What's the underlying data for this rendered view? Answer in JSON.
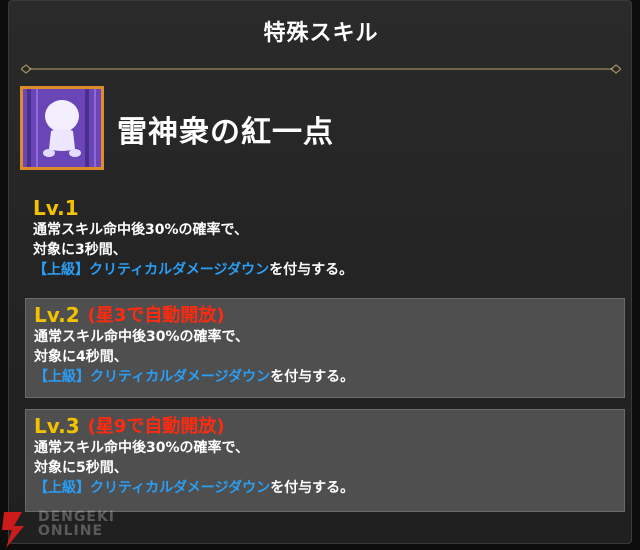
{
  "header": {
    "title": "特殊スキル"
  },
  "skill": {
    "name": "雷神衆の紅一点",
    "icon": "character-portrait-icon"
  },
  "levels": [
    {
      "label": "Lv.1",
      "unlock": "",
      "lines": [
        "通常スキル命中後30%の確率で、",
        "対象に3秒間、"
      ],
      "effect": "【上級】クリティカルダメージダウン",
      "suffix": "を付与する。"
    },
    {
      "label": "Lv.2",
      "unlock": "(星3で自動開放)",
      "lines": [
        "通常スキル命中後30%の確率で、",
        "対象に4秒間、"
      ],
      "effect": "【上級】クリティカルダメージダウン",
      "suffix": "を付与する。"
    },
    {
      "label": "Lv.3",
      "unlock": "(星9で自動開放)",
      "lines": [
        "通常スキル命中後30%の確率で、",
        "対象に5秒間、"
      ],
      "effect": "【上級】クリティカルダメージダウン",
      "suffix": "を付与する。"
    }
  ],
  "watermark": {
    "line1": "DENGEKI",
    "line2": "ONLINE"
  },
  "colors": {
    "level_label": "#f2c200",
    "unlock_text": "#ff2a10",
    "effect_text": "#2a9df4",
    "icon_border": "#e08b2a",
    "icon_bg": "#7d58c6",
    "watermark_red": "#cc1b1b"
  }
}
